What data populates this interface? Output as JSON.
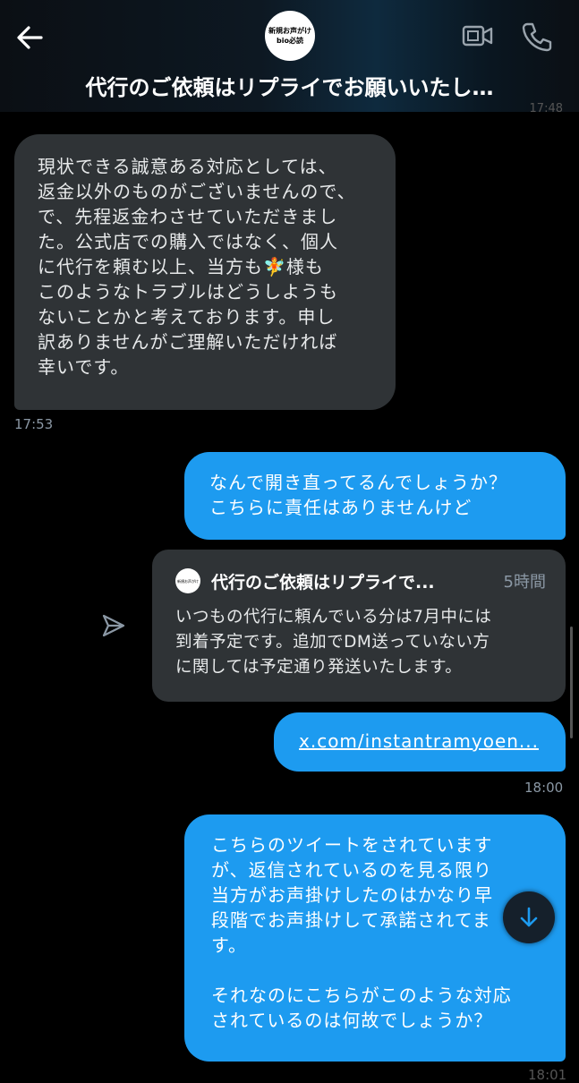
{
  "header": {
    "avatar_line1": "新規お声がけ",
    "avatar_line2": "bio必読",
    "title": "代行のご依頼はリプライでお願いいたし…",
    "peek_time": "17:48",
    "icons": [
      "back-arrow-icon",
      "video-call-icon",
      "phone-icon"
    ],
    "accent_color": "#1d9bf0"
  },
  "messages": [
    {
      "direction": "incoming",
      "lines": [
        "現状できる誠意ある対応としては、",
        "返金以外のものがございませんので、",
        "で、先程返金わさせていただきまし",
        "た。公式店での購入ではなく、個人",
        "に代行を頼む以上、当方も🧚様も",
        "このようなトラブルはどうしようも",
        "ないことかと考えております。申し",
        "訳ありませんがご理解いただければ",
        "幸いです。"
      ],
      "time": "17:53"
    },
    {
      "direction": "outgoing",
      "lines": [
        "なんで開き直ってるんでしょうか？",
        "こちらに責任はありませんけど"
      ]
    },
    {
      "direction": "outgoing",
      "type": "quoted-post",
      "quote": {
        "name": "代行のご依頼はリプライで...",
        "time": "5時間",
        "lines": [
          "いつもの代行に頼んでいる分は7月中には",
          "到着予定です。追加でDM送っていない方",
          "に関しては予定通り発送いたします。"
        ]
      }
    },
    {
      "direction": "outgoing",
      "type": "link",
      "text": "x.com/instantramyoen...",
      "time": "18:00"
    },
    {
      "direction": "outgoing",
      "lines": [
        "こちらのツイートをされています",
        "が、返信されているのを見る限り",
        "当方がお声掛けしたのはかなり早",
        "段階でお声掛けして承諾されてま",
        "す。",
        "",
        "それなのにこちらがこのような対応",
        "されているのは何故でしょうか？"
      ],
      "time": "18:01"
    }
  ]
}
